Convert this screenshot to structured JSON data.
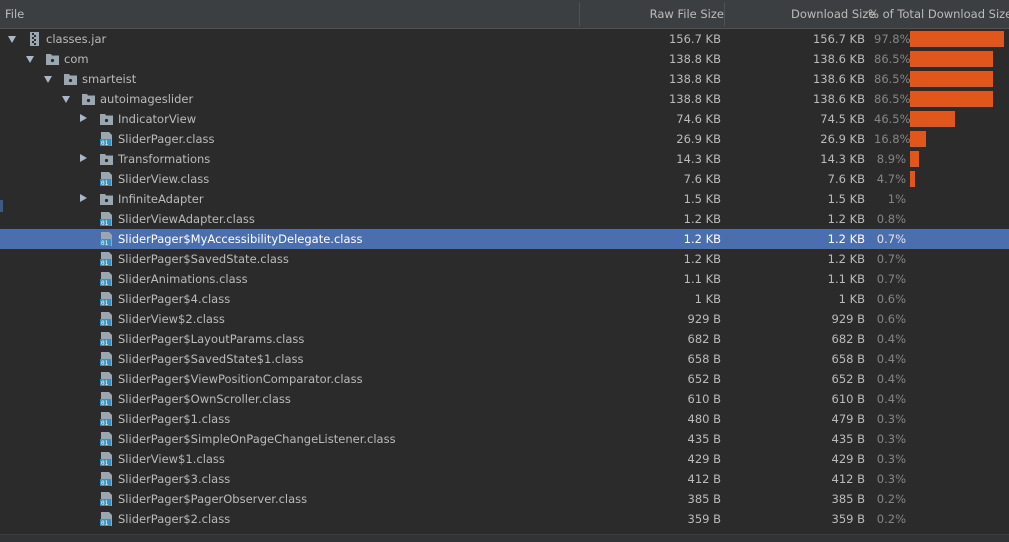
{
  "columns": {
    "file": "File",
    "raw": "Raw File Size",
    "download": "Download Size",
    "percent": "% of Total Download Size"
  },
  "colors": {
    "selection": "#4b6eaf",
    "bar": "#e0561b",
    "folder_icon": "#9aa7b0",
    "class_icon": "#3592c4"
  },
  "rows": [
    {
      "name": "classes.jar",
      "raw": "156.7 KB",
      "download": "156.7 KB",
      "percent": "97.8%",
      "fraction": 0.978,
      "depth": 0,
      "icon": "jar-icon",
      "arrow": "down",
      "selected": false
    },
    {
      "name": "com",
      "raw": "138.8 KB",
      "download": "138.6 KB",
      "percent": "86.5%",
      "fraction": 0.865,
      "depth": 1,
      "icon": "package-folder-icon",
      "arrow": "down",
      "selected": false
    },
    {
      "name": "smarteist",
      "raw": "138.8 KB",
      "download": "138.6 KB",
      "percent": "86.5%",
      "fraction": 0.865,
      "depth": 2,
      "icon": "package-folder-icon",
      "arrow": "down",
      "selected": false
    },
    {
      "name": "autoimageslider",
      "raw": "138.8 KB",
      "download": "138.6 KB",
      "percent": "86.5%",
      "fraction": 0.865,
      "depth": 3,
      "icon": "package-folder-icon",
      "arrow": "down",
      "selected": false
    },
    {
      "name": "IndicatorView",
      "raw": "74.6 KB",
      "download": "74.5 KB",
      "percent": "46.5%",
      "fraction": 0.465,
      "depth": 4,
      "icon": "package-folder-icon",
      "arrow": "right",
      "selected": false
    },
    {
      "name": "SliderPager.class",
      "raw": "26.9 KB",
      "download": "26.9 KB",
      "percent": "16.8%",
      "fraction": 0.168,
      "depth": 4,
      "icon": "class-file-icon",
      "arrow": "none",
      "selected": false
    },
    {
      "name": "Transformations",
      "raw": "14.3 KB",
      "download": "14.3 KB",
      "percent": "8.9%",
      "fraction": 0.089,
      "depth": 4,
      "icon": "package-folder-icon",
      "arrow": "right",
      "selected": false
    },
    {
      "name": "SliderView.class",
      "raw": "7.6 KB",
      "download": "7.6 KB",
      "percent": "4.7%",
      "fraction": 0.047,
      "depth": 4,
      "icon": "class-file-icon",
      "arrow": "none",
      "selected": false
    },
    {
      "name": "InfiniteAdapter",
      "raw": "1.5 KB",
      "download": "1.5 KB",
      "percent": "1%",
      "fraction": 0.0,
      "depth": 4,
      "icon": "package-folder-icon",
      "arrow": "right",
      "selected": false
    },
    {
      "name": "SliderViewAdapter.class",
      "raw": "1.2 KB",
      "download": "1.2 KB",
      "percent": "0.8%",
      "fraction": 0.0,
      "depth": 4,
      "icon": "class-file-icon",
      "arrow": "none",
      "selected": false
    },
    {
      "name": "SliderPager$MyAccessibilityDelegate.class",
      "raw": "1.2 KB",
      "download": "1.2 KB",
      "percent": "0.7%",
      "fraction": 0.0,
      "depth": 4,
      "icon": "class-file-icon",
      "arrow": "none",
      "selected": true
    },
    {
      "name": "SliderPager$SavedState.class",
      "raw": "1.2 KB",
      "download": "1.2 KB",
      "percent": "0.7%",
      "fraction": 0.0,
      "depth": 4,
      "icon": "class-file-icon",
      "arrow": "none",
      "selected": false
    },
    {
      "name": "SliderAnimations.class",
      "raw": "1.1 KB",
      "download": "1.1 KB",
      "percent": "0.7%",
      "fraction": 0.0,
      "depth": 4,
      "icon": "class-file-icon",
      "arrow": "none",
      "selected": false
    },
    {
      "name": "SliderPager$4.class",
      "raw": "1 KB",
      "download": "1 KB",
      "percent": "0.6%",
      "fraction": 0.0,
      "depth": 4,
      "icon": "class-file-icon",
      "arrow": "none",
      "selected": false
    },
    {
      "name": "SliderView$2.class",
      "raw": "929 B",
      "download": "929 B",
      "percent": "0.6%",
      "fraction": 0.0,
      "depth": 4,
      "icon": "class-file-icon",
      "arrow": "none",
      "selected": false
    },
    {
      "name": "SliderPager$LayoutParams.class",
      "raw": "682 B",
      "download": "682 B",
      "percent": "0.4%",
      "fraction": 0.0,
      "depth": 4,
      "icon": "class-file-icon",
      "arrow": "none",
      "selected": false
    },
    {
      "name": "SliderPager$SavedState$1.class",
      "raw": "658 B",
      "download": "658 B",
      "percent": "0.4%",
      "fraction": 0.0,
      "depth": 4,
      "icon": "class-file-icon",
      "arrow": "none",
      "selected": false
    },
    {
      "name": "SliderPager$ViewPositionComparator.class",
      "raw": "652 B",
      "download": "652 B",
      "percent": "0.4%",
      "fraction": 0.0,
      "depth": 4,
      "icon": "class-file-icon",
      "arrow": "none",
      "selected": false
    },
    {
      "name": "SliderPager$OwnScroller.class",
      "raw": "610 B",
      "download": "610 B",
      "percent": "0.4%",
      "fraction": 0.0,
      "depth": 4,
      "icon": "class-file-icon",
      "arrow": "none",
      "selected": false
    },
    {
      "name": "SliderPager$1.class",
      "raw": "480 B",
      "download": "479 B",
      "percent": "0.3%",
      "fraction": 0.0,
      "depth": 4,
      "icon": "class-file-icon",
      "arrow": "none",
      "selected": false
    },
    {
      "name": "SliderPager$SimpleOnPageChangeListener.class",
      "raw": "435 B",
      "download": "435 B",
      "percent": "0.3%",
      "fraction": 0.0,
      "depth": 4,
      "icon": "class-file-icon",
      "arrow": "none",
      "selected": false
    },
    {
      "name": "SliderView$1.class",
      "raw": "429 B",
      "download": "429 B",
      "percent": "0.3%",
      "fraction": 0.0,
      "depth": 4,
      "icon": "class-file-icon",
      "arrow": "none",
      "selected": false
    },
    {
      "name": "SliderPager$3.class",
      "raw": "412 B",
      "download": "412 B",
      "percent": "0.3%",
      "fraction": 0.0,
      "depth": 4,
      "icon": "class-file-icon",
      "arrow": "none",
      "selected": false
    },
    {
      "name": "SliderPager$PagerObserver.class",
      "raw": "385 B",
      "download": "385 B",
      "percent": "0.2%",
      "fraction": 0.0,
      "depth": 4,
      "icon": "class-file-icon",
      "arrow": "none",
      "selected": false
    },
    {
      "name": "SliderPager$2.class",
      "raw": "359 B",
      "download": "359 B",
      "percent": "0.2%",
      "fraction": 0.0,
      "depth": 4,
      "icon": "class-file-icon",
      "arrow": "none",
      "selected": false
    }
  ]
}
